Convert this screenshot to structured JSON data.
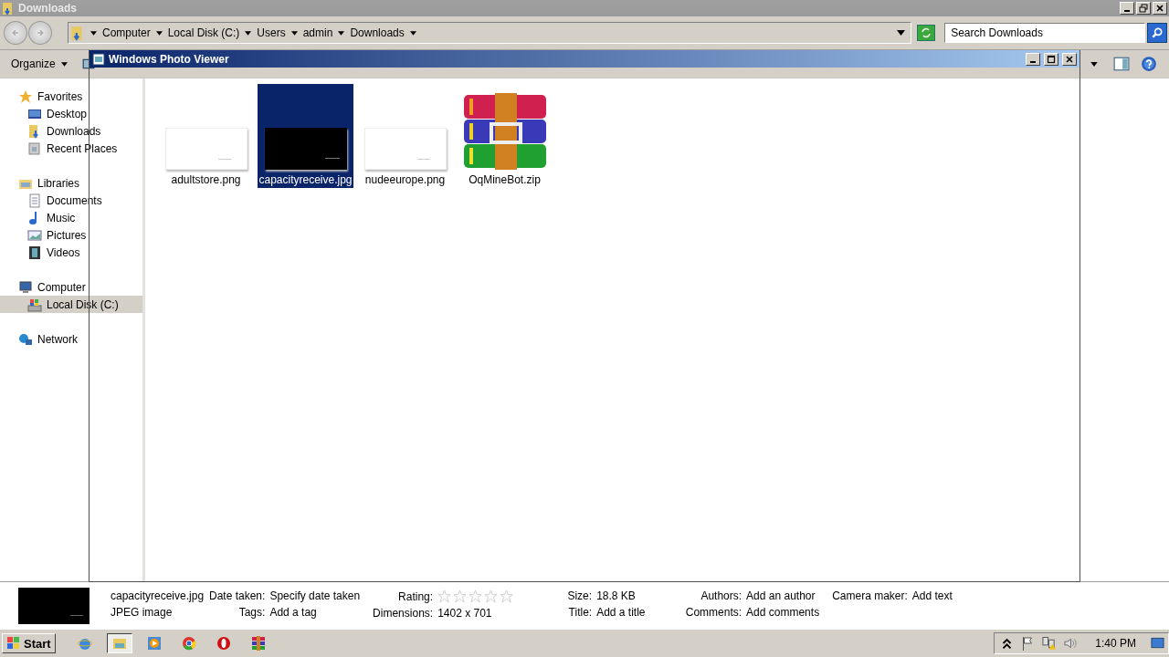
{
  "window": {
    "title": "Downloads"
  },
  "address": {
    "breadcrumbs": [
      "Computer",
      "Local Disk (C:)",
      "Users",
      "admin",
      "Downloads"
    ]
  },
  "search": {
    "placeholder": "Search Downloads"
  },
  "toolbar": {
    "organize": "Organize"
  },
  "photo_viewer": {
    "title": "Windows Photo Viewer"
  },
  "sidebar": {
    "groups": [
      {
        "label": "Favorites",
        "kind": "star",
        "selected": false,
        "children": [
          {
            "label": "Desktop",
            "kind": "desktop",
            "selected": false
          },
          {
            "label": "Downloads",
            "kind": "downloads",
            "selected": false
          },
          {
            "label": "Recent Places",
            "kind": "recent",
            "selected": false
          }
        ]
      },
      {
        "label": "Libraries",
        "kind": "library",
        "selected": false,
        "children": [
          {
            "label": "Documents",
            "kind": "document",
            "selected": false
          },
          {
            "label": "Music",
            "kind": "music",
            "selected": false
          },
          {
            "label": "Pictures",
            "kind": "pictures",
            "selected": false
          },
          {
            "label": "Videos",
            "kind": "videos",
            "selected": false
          }
        ]
      },
      {
        "label": "Computer",
        "kind": "computer",
        "selected": false,
        "children": [
          {
            "label": "Local Disk (C:)",
            "kind": "disk",
            "selected": true
          }
        ]
      },
      {
        "label": "Network",
        "kind": "network",
        "selected": false
      }
    ]
  },
  "files": [
    {
      "name": "adultstore.png",
      "kind": "light-image",
      "selected": false
    },
    {
      "name": "capacityreceive.jpg",
      "kind": "dark-image",
      "selected": true
    },
    {
      "name": "nudeeurope.png",
      "kind": "light-image",
      "selected": false
    },
    {
      "name": "OqMineBot.zip",
      "kind": "archive",
      "selected": false
    }
  ],
  "details": {
    "file_name": "capacityreceive.jpg",
    "file_type": "JPEG image",
    "columns": [
      [
        {
          "label": "Date taken:",
          "value": "Specify date taken"
        },
        {
          "label": "Tags:",
          "value": "Add a tag"
        }
      ],
      [
        {
          "label": "Rating:",
          "kind": "rating",
          "stars": 0
        },
        {
          "label": "Dimensions:",
          "value": "1402 x 701"
        }
      ],
      [
        {
          "label": "Size:",
          "value": "18.8 KB"
        },
        {
          "label": "Title:",
          "value": "Add a title"
        }
      ],
      [
        {
          "label": "Authors:",
          "value": "Add an author"
        },
        {
          "label": "Comments:",
          "value": "Add comments"
        }
      ],
      [
        {
          "label": "Camera maker:",
          "value": "Add text"
        }
      ]
    ]
  },
  "taskbar": {
    "start": "Start",
    "apps": [
      {
        "kind": "ie",
        "selected": false
      },
      {
        "kind": "explorer",
        "selected": true
      },
      {
        "kind": "media",
        "selected": false
      },
      {
        "kind": "chrome",
        "selected": false
      },
      {
        "kind": "opera",
        "selected": false
      },
      {
        "kind": "winrar",
        "selected": false
      }
    ],
    "clock": "1:40 PM"
  }
}
